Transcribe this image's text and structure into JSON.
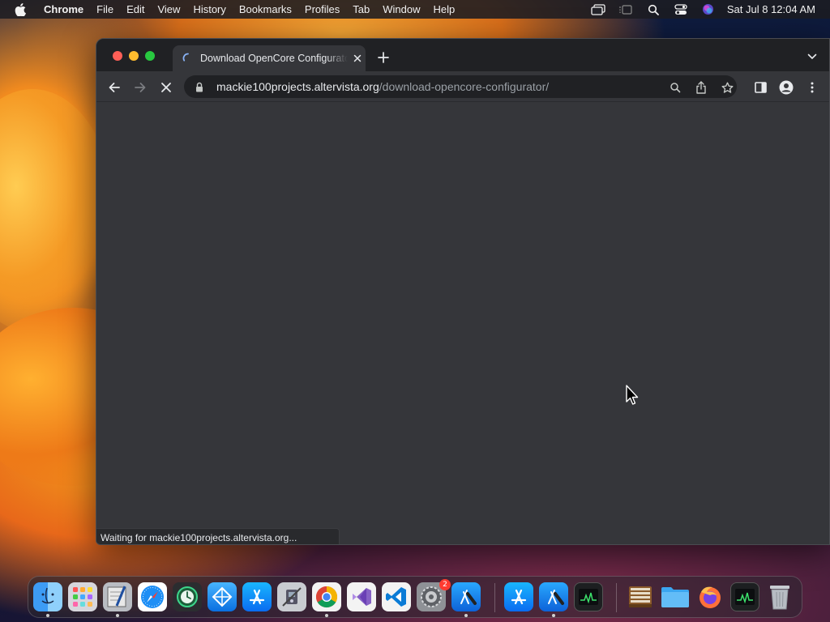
{
  "menubar": {
    "app_name": "Chrome",
    "items": [
      "File",
      "Edit",
      "View",
      "History",
      "Bookmarks",
      "Profiles",
      "Tab",
      "Window",
      "Help"
    ],
    "clock": "Sat Jul 8  12:04 AM",
    "status_icons": [
      "screen-mirroring-icon",
      "stage-manager-icon",
      "spotlight-search-icon",
      "control-center-icon",
      "siri-icon"
    ]
  },
  "browser": {
    "tab_title": "Download OpenCore Configurator",
    "url_host": "mackie100projects.altervista.org",
    "url_path": "/download-opencore-configurator/",
    "status_text": "Waiting for mackie100projects.altervista.org..."
  },
  "dock": {
    "apps": [
      {
        "name": "Finder",
        "icon": "finder-icon"
      },
      {
        "name": "Launchpad",
        "icon": "launchpad-icon"
      },
      {
        "name": "Script Editor",
        "icon": "script-editor-icon"
      },
      {
        "name": "Safari",
        "icon": "safari-icon"
      },
      {
        "name": "Time Machine",
        "icon": "time-machine-icon"
      },
      {
        "name": "Network Radar",
        "icon": "network-icon"
      },
      {
        "name": "App Store",
        "icon": "app-store-icon"
      },
      {
        "name": "System Information",
        "icon": "system-info-icon"
      },
      {
        "name": "Google Chrome",
        "icon": "chrome-icon"
      },
      {
        "name": "Visual Studio",
        "icon": "visual-studio-icon"
      },
      {
        "name": "Visual Studio Code",
        "icon": "vscode-icon"
      },
      {
        "name": "System Preferences",
        "icon": "system-preferences-icon",
        "badge": "2"
      },
      {
        "name": "Xcode",
        "icon": "xcode-icon"
      },
      {
        "name": "App Store",
        "icon": "app-store-icon"
      },
      {
        "name": "Xcode",
        "icon": "xcode-icon"
      },
      {
        "name": "Activity Monitor",
        "icon": "activity-monitor-icon"
      },
      {
        "name": "Archive Utility",
        "icon": "archive-icon"
      },
      {
        "name": "Folder",
        "icon": "folder-icon"
      },
      {
        "name": "Firefox",
        "icon": "firefox-icon"
      },
      {
        "name": "Activity Monitor",
        "icon": "activity-monitor-icon"
      },
      {
        "name": "Trash",
        "icon": "trash-icon"
      }
    ]
  },
  "colors": {
    "tab_strip": "#202124",
    "toolbar": "#35363a",
    "omnibox": "#202124",
    "traffic_close": "#ff5f57",
    "traffic_minimize": "#febc2e",
    "traffic_zoom": "#28c840"
  }
}
